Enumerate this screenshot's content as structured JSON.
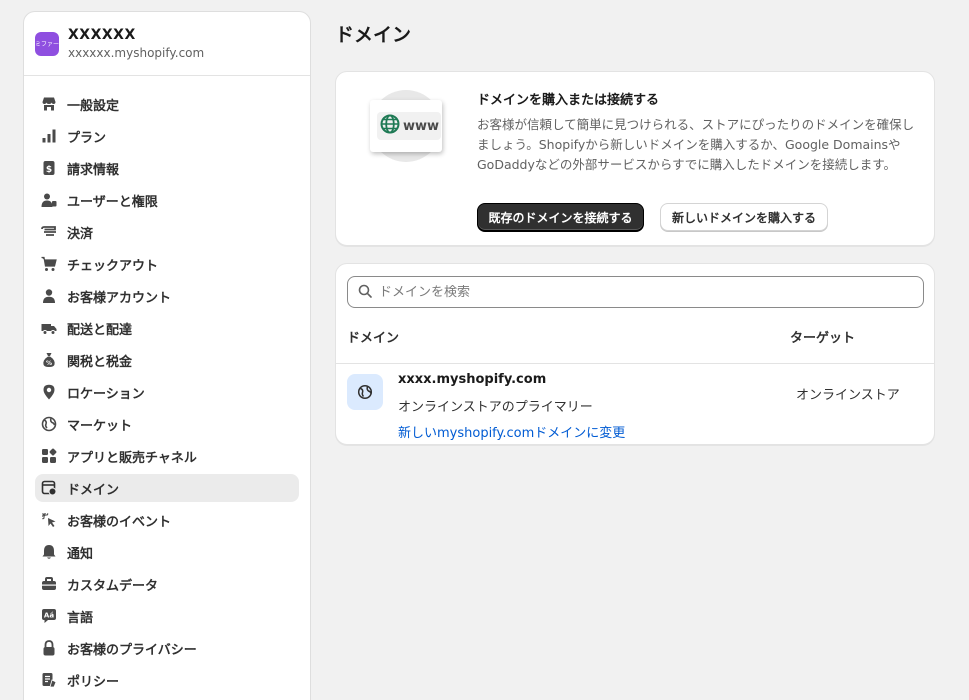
{
  "store": {
    "name": "XXXXXX",
    "url": "xxxxxx.myshopify.com",
    "logo_text": "ミファー"
  },
  "sidebar": {
    "items": [
      {
        "label": "一般設定",
        "icon": "store-icon"
      },
      {
        "label": "プラン",
        "icon": "plan-chart-icon"
      },
      {
        "label": "請求情報",
        "icon": "billing-icon"
      },
      {
        "label": "ユーザーと権限",
        "icon": "users-icon"
      },
      {
        "label": "決済",
        "icon": "payments-icon"
      },
      {
        "label": "チェックアウト",
        "icon": "cart-icon"
      },
      {
        "label": "お客様アカウント",
        "icon": "person-icon"
      },
      {
        "label": "配送と配達",
        "icon": "truck-icon"
      },
      {
        "label": "関税と税金",
        "icon": "tax-bag-icon"
      },
      {
        "label": "ロケーション",
        "icon": "location-pin-icon"
      },
      {
        "label": "マーケット",
        "icon": "globe-icon"
      },
      {
        "label": "アプリと販売チャネル",
        "icon": "apps-icon"
      },
      {
        "label": "ドメイン",
        "icon": "domain-icon",
        "active": true
      },
      {
        "label": "お客様のイベント",
        "icon": "cursor-click-icon"
      },
      {
        "label": "通知",
        "icon": "bell-icon"
      },
      {
        "label": "カスタムデータ",
        "icon": "custom-data-icon"
      },
      {
        "label": "言語",
        "icon": "language-icon"
      },
      {
        "label": "お客様のプライバシー",
        "icon": "lock-icon"
      },
      {
        "label": "ポリシー",
        "icon": "policy-icon"
      }
    ]
  },
  "page": {
    "title": "ドメイン"
  },
  "promo": {
    "illustration_text": "www",
    "title": "ドメインを購入または接続する",
    "description": "お客様が信頼して簡単に見つけられる、ストアにぴったりのドメインを確保しましょう。Shopifyから新しいドメインを購入するか、Google DomainsやGoDaddyなどの外部サービスからすでに購入したドメインを接続します。",
    "primary_button": "既存のドメインを接続する",
    "secondary_button": "新しいドメインを購入する"
  },
  "domains": {
    "search_placeholder": "ドメインを検索",
    "columns": {
      "domain": "ドメイン",
      "target": "ターゲット"
    },
    "rows": [
      {
        "domain": "xxxx.myshopify.com",
        "description": "オンラインストアのプライマリー",
        "link": "新しいmyshopify.comドメインに変更",
        "target": "オンラインストア"
      }
    ]
  },
  "colors": {
    "accent_link": "#005bd3",
    "primary_button": "#303030",
    "active_nav": "#ebebeb",
    "row_icon_bg": "#dbeafe",
    "logo_bg": "#8f4fe0",
    "globe_green": "#1f7a55"
  }
}
